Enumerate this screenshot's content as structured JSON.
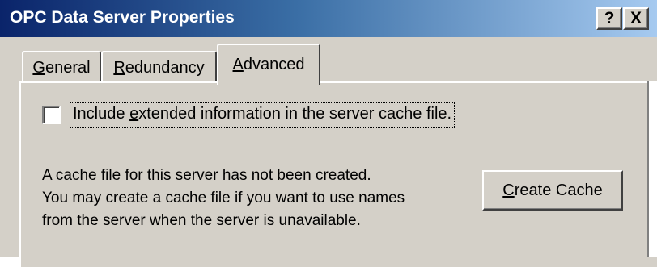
{
  "window": {
    "title": "OPC Data Server Properties",
    "help_button": "?",
    "close_button": "X"
  },
  "tabs": [
    {
      "prefix": "",
      "accel": "G",
      "rest": "eneral",
      "selected": false
    },
    {
      "prefix": "",
      "accel": "R",
      "rest": "edundancy",
      "selected": false
    },
    {
      "prefix": "",
      "accel": "A",
      "rest": "dvanced",
      "selected": true
    }
  ],
  "advanced": {
    "checkbox": {
      "checked": false,
      "label_prefix": "Include ",
      "label_accel": "e",
      "label_rest": "xtended information in the server cache file."
    },
    "info_lines": [
      "A cache file for this server has not been created.",
      "You may create a cache file if you want to use names",
      "from the server when the server is unavailable."
    ],
    "create_cache_button": {
      "accel": "C",
      "rest": "reate Cache"
    }
  },
  "colors": {
    "dialog_face": "#d4d0c8",
    "title_start": "#0a246a",
    "title_end": "#a6caf0"
  }
}
